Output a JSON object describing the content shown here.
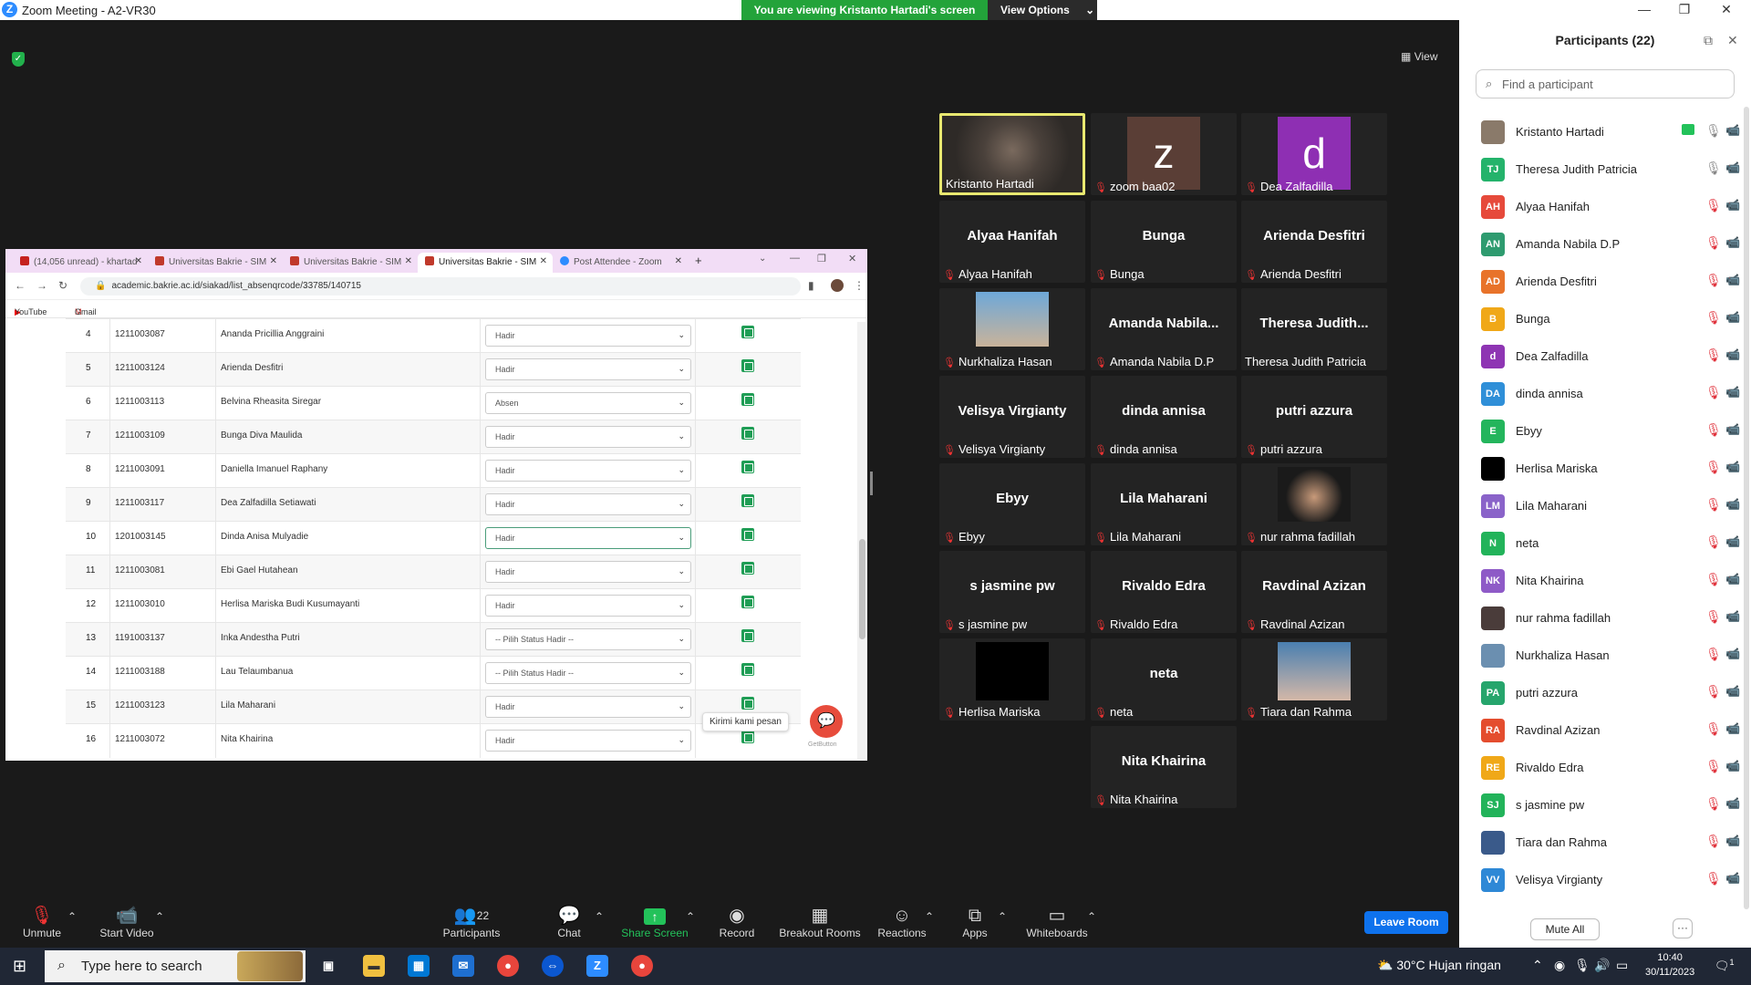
{
  "window": {
    "title": "Zoom Meeting - A2-VR30",
    "minimize": "—",
    "restore": "❐",
    "close": "✕"
  },
  "share_banner": {
    "text": "You are viewing Kristanto Hartadi's screen",
    "view_options": "View Options"
  },
  "view_button": "View",
  "browser": {
    "tabs": [
      {
        "label": "(14,056 unread) - khartad",
        "color": "#c5221f"
      },
      {
        "label": "Universitas Bakrie - SIM",
        "color": "#c0392b"
      },
      {
        "label": "Universitas Bakrie - SIM",
        "color": "#c0392b"
      },
      {
        "label": "Universitas Bakrie - SIM",
        "color": "#c0392b"
      },
      {
        "label": "Post Attendee - Zoom",
        "color": "#2d8cff"
      }
    ],
    "new_tab": "+",
    "url": "academic.bakrie.ac.id/siakad/list_absenqrcode/33785/140715",
    "bookmarks": [
      "YouTube",
      "Gmail"
    ],
    "rows": [
      {
        "no": "4",
        "nim": "1211003087",
        "name": "Ananda Pricillia Anggraini",
        "status": "Hadir"
      },
      {
        "no": "5",
        "nim": "1211003124",
        "name": "Arienda Desfitri",
        "status": "Hadir"
      },
      {
        "no": "6",
        "nim": "1211003113",
        "name": "Belvina Rheasita Siregar",
        "status": "Absen"
      },
      {
        "no": "7",
        "nim": "1211003109",
        "name": "Bunga Diva Maulida",
        "status": "Hadir"
      },
      {
        "no": "8",
        "nim": "1211003091",
        "name": "Daniella Imanuel Raphany",
        "status": "Hadir"
      },
      {
        "no": "9",
        "nim": "1211003117",
        "name": "Dea Zalfadilla Setiawati",
        "status": "Hadir"
      },
      {
        "no": "10",
        "nim": "1201003145",
        "name": "Dinda Anisa Mulyadie",
        "status": "Hadir"
      },
      {
        "no": "11",
        "nim": "1211003081",
        "name": "Ebi Gael Hutahean",
        "status": "Hadir"
      },
      {
        "no": "12",
        "nim": "1211003010",
        "name": "Herlisa Mariska Budi Kusumayanti",
        "status": "Hadir"
      },
      {
        "no": "13",
        "nim": "1191003137",
        "name": "Inka Andestha Putri",
        "status": "-- Pilih Status Hadir --"
      },
      {
        "no": "14",
        "nim": "1211003188",
        "name": "Lau Telaumbanua",
        "status": "-- Pilih Status Hadir --"
      },
      {
        "no": "15",
        "nim": "1211003123",
        "name": "Lila Maharani",
        "status": "Hadir"
      },
      {
        "no": "16",
        "nim": "1211003072",
        "name": "Nita Khairina",
        "status": "Hadir"
      }
    ],
    "chat_tooltip": "Kirimi kami pesan",
    "getbutton": "GetButton"
  },
  "tiles": [
    {
      "big": "",
      "label": "Kristanto Hartadi",
      "muted": false
    },
    {
      "big": "z",
      "label": "zoom baa02",
      "muted": true
    },
    {
      "big": "d",
      "label": "Dea Zalfadilla",
      "muted": true
    },
    {
      "big": "Alyaa Hanifah",
      "label": "Alyaa Hanifah",
      "muted": true
    },
    {
      "big": "Bunga",
      "label": "Bunga",
      "muted": true
    },
    {
      "big": "Arienda Desfitri",
      "label": "Arienda Desfitri",
      "muted": true
    },
    {
      "big": "",
      "label": "Nurkhaliza Hasan",
      "muted": true
    },
    {
      "big": "Amanda Nabila...",
      "label": "Amanda Nabila D.P",
      "muted": true
    },
    {
      "big": "Theresa Judith...",
      "label": "Theresa Judith Patricia",
      "muted": false
    },
    {
      "big": "Velisya Virgianty",
      "label": "Velisya Virgianty",
      "muted": true
    },
    {
      "big": "dinda annisa",
      "label": "dinda annisa",
      "muted": true
    },
    {
      "big": "putri azzura",
      "label": "putri azzura",
      "muted": true
    },
    {
      "big": "Ebyy",
      "label": "Ebyy",
      "muted": true
    },
    {
      "big": "Lila Maharani",
      "label": "Lila Maharani",
      "muted": true
    },
    {
      "big": "",
      "label": "nur rahma fadillah",
      "muted": true
    },
    {
      "big": "s jasmine pw",
      "label": "s jasmine pw",
      "muted": true
    },
    {
      "big": "Rivaldo Edra",
      "label": "Rivaldo Edra",
      "muted": true
    },
    {
      "big": "Ravdinal Azizan",
      "label": "Ravdinal Azizan",
      "muted": true
    },
    {
      "big": "",
      "label": "Herlisa Mariska",
      "muted": true
    },
    {
      "big": "neta",
      "label": "neta",
      "muted": true
    },
    {
      "big": "",
      "label": "Tiara dan Rahma",
      "muted": true
    },
    {
      "big": "Nita Khairina",
      "label": "Nita Khairina",
      "muted": true
    }
  ],
  "panel": {
    "title": "Participants (22)",
    "search_placeholder": "Find a participant",
    "participants": [
      {
        "initials": "",
        "name": "Kristanto Hartadi",
        "color": "#8a7a6a"
      },
      {
        "initials": "TJ",
        "name": "Theresa Judith Patricia",
        "color": "#24b36b"
      },
      {
        "initials": "AH",
        "name": "Alyaa Hanifah",
        "color": "#e64a3b"
      },
      {
        "initials": "AN",
        "name": "Amanda Nabila D.P",
        "color": "#2e9b6f"
      },
      {
        "initials": "AD",
        "name": "Arienda Desfitri",
        "color": "#e8732a"
      },
      {
        "initials": "B",
        "name": "Bunga",
        "color": "#f0a818"
      },
      {
        "initials": "d",
        "name": "Dea Zalfadilla",
        "color": "#8e35b3"
      },
      {
        "initials": "DA",
        "name": "dinda annisa",
        "color": "#2f8fd8"
      },
      {
        "initials": "E",
        "name": "Ebyy",
        "color": "#23b55c"
      },
      {
        "initials": "",
        "name": "Herlisa Mariska",
        "color": "#000000"
      },
      {
        "initials": "LM",
        "name": "Lila Maharani",
        "color": "#8a63c9"
      },
      {
        "initials": "N",
        "name": "neta",
        "color": "#22b35a"
      },
      {
        "initials": "NK",
        "name": "Nita Khairina",
        "color": "#8e5ac7"
      },
      {
        "initials": "",
        "name": "nur rahma fadillah",
        "color": "#4a3c3a"
      },
      {
        "initials": "",
        "name": "Nurkhaliza Hasan",
        "color": "#6b8fb0"
      },
      {
        "initials": "PA",
        "name": "putri azzura",
        "color": "#26a56c"
      },
      {
        "initials": "RA",
        "name": "Ravdinal Azizan",
        "color": "#e44d2e"
      },
      {
        "initials": "RE",
        "name": "Rivaldo Edra",
        "color": "#f0a818"
      },
      {
        "initials": "SJ",
        "name": "s jasmine pw",
        "color": "#22b35a"
      },
      {
        "initials": "",
        "name": "Tiara dan Rahma",
        "color": "#3a5a8a"
      },
      {
        "initials": "VV",
        "name": "Velisya Virgianty",
        "color": "#2e88d6"
      }
    ],
    "mute_all": "Mute All",
    "more": "···"
  },
  "toolbar": {
    "unmute": "Unmute",
    "start_video": "Start Video",
    "participants": "Participants",
    "participant_count": "22",
    "chat": "Chat",
    "share_screen": "Share Screen",
    "record": "Record",
    "breakout": "Breakout Rooms",
    "reactions": "Reactions",
    "apps": "Apps",
    "whiteboards": "Whiteboards",
    "leave": "Leave Room"
  },
  "taskbar": {
    "search_placeholder": "Type here to search",
    "weather": "30°C  Hujan ringan",
    "time": "10:40",
    "date": "30/11/2023",
    "notif": "1"
  }
}
